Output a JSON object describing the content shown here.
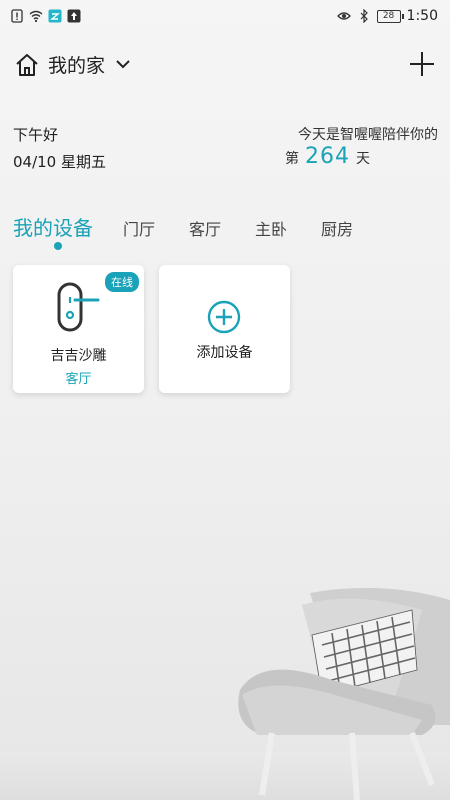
{
  "status_bar": {
    "time": "1:50",
    "battery": "28",
    "icons": [
      "alert-icon",
      "wifi-icon",
      "app-notification-icon",
      "upload-icon",
      "eye-icon",
      "bluetooth-icon"
    ]
  },
  "header": {
    "title": "我的家",
    "home_icon": "home-icon",
    "dropdown_icon": "chevron-down-icon",
    "add_icon": "plus-icon"
  },
  "greeting": {
    "text": "下午好",
    "date": "04/10 星期五",
    "company_line": "今天是智喔喔陪伴你的",
    "days_prefix": "第",
    "days_count": "264",
    "days_suffix": "天"
  },
  "tabs": [
    {
      "label": "我的设备",
      "active": true
    },
    {
      "label": "门厅"
    },
    {
      "label": "客厅"
    },
    {
      "label": "主卧"
    },
    {
      "label": "厨房"
    }
  ],
  "devices": [
    {
      "name": "吉吉沙雕",
      "room": "客厅",
      "status": "在线",
      "icon": "smart-lock-icon"
    }
  ],
  "add_device": {
    "label": "添加设备",
    "icon": "add-circle-icon"
  },
  "colors": {
    "accent": "#1aa3b8",
    "background": "#f0f0f0",
    "card": "#ffffff"
  }
}
